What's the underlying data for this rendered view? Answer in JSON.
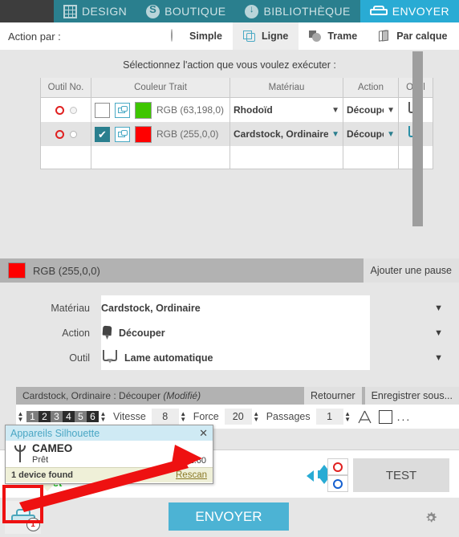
{
  "topnav": {
    "items": [
      {
        "label": "DESIGN",
        "icon": "grid-icon",
        "active": false
      },
      {
        "label": "BOUTIQUE",
        "icon": "store-icon",
        "active": false
      },
      {
        "label": "BIBLIOTHÈQUE",
        "icon": "cloud-download-icon",
        "active": false
      },
      {
        "label": "ENVOYER",
        "icon": "cutter-icon",
        "active": true
      }
    ],
    "active_color": "#29abd4",
    "bar_color": "#2a7f8e"
  },
  "actionbar": {
    "label": "Action par :",
    "tabs": [
      {
        "label": "Simple",
        "icon": "circle-outline-icon",
        "selected": false
      },
      {
        "label": "Ligne",
        "icon": "lines-overlap-icon",
        "selected": true
      },
      {
        "label": "Trame",
        "icon": "fill-shapes-icon",
        "selected": false
      },
      {
        "label": "Par calque",
        "icon": "layers-icon",
        "selected": false
      }
    ]
  },
  "main": {
    "prompt": "Sélectionnez l'action que vous voulez exécuter :",
    "table": {
      "headers": [
        "Outil No.",
        "Couleur Trait",
        "Matériau",
        "Action",
        "Outil"
      ],
      "rows": [
        {
          "tool_no_primary": "red-circle",
          "tool_no_secondary": "gray-circle",
          "checked": false,
          "color_label": "RGB (63,198,0)",
          "color_hex": "#3ec600",
          "material": "Rhodoïd",
          "action": "Découpe",
          "tool_icon": "blade-icon",
          "selected": false
        },
        {
          "tool_no_primary": "red-circle",
          "tool_no_secondary": "white-circle",
          "checked": true,
          "color_label": "RGB (255,0,0)",
          "color_hex": "#ff0000",
          "material": "Cardstock, Ordinaire",
          "action": "Découpe",
          "tool_icon": "blade-icon",
          "selected": true
        }
      ]
    }
  },
  "midpanel": {
    "header_color_label": "RGB (255,0,0)",
    "header_color_hex": "#ff0000",
    "add_pause_label": "Ajouter une pause",
    "fields": [
      {
        "label": "Matériau",
        "value": "Cardstock, Ordinaire",
        "icon": null,
        "caret": "▼"
      },
      {
        "label": "Action",
        "value": "Découper",
        "icon": "pen-icon",
        "caret": "▼"
      },
      {
        "label": "Outil",
        "value": "Lame automatique",
        "icon": "blade-icon",
        "caret": "▼"
      }
    ]
  },
  "settings": {
    "title_main": "Cardstock, Ordinaire : Découper ",
    "title_modified": "(Modifié)",
    "revert_label": "Retourner",
    "saveas_label": "Enregistrer sous...",
    "speed_label": "Vitesse",
    "speed_value": "8",
    "force_label": "Force",
    "force_value": "20",
    "passes_label": "Passages",
    "passes_value": "1",
    "chips": [
      "1",
      "2",
      "3",
      "4",
      "5",
      "6"
    ],
    "more_label": "..."
  },
  "popup": {
    "title": "Appareils Silhouette",
    "close_label": "✕",
    "device_name": "CAMEO",
    "device_status": "Prêt",
    "firmware": "1.60",
    "found_label": "1 device found",
    "rescan_label": "Rescan"
  },
  "bottom": {
    "status_pret": "Prêt",
    "test_label": "TEST",
    "send_label": "ENVOYER",
    "device_badge": "1",
    "gear_icon": "gear-icon",
    "arrow_pad_icon": "move-arrows-icon",
    "cut_circle_red": "#e02020",
    "cut_circle_blue": "#1560d0"
  },
  "annotation": {
    "highlight_color": "#ee1111"
  }
}
